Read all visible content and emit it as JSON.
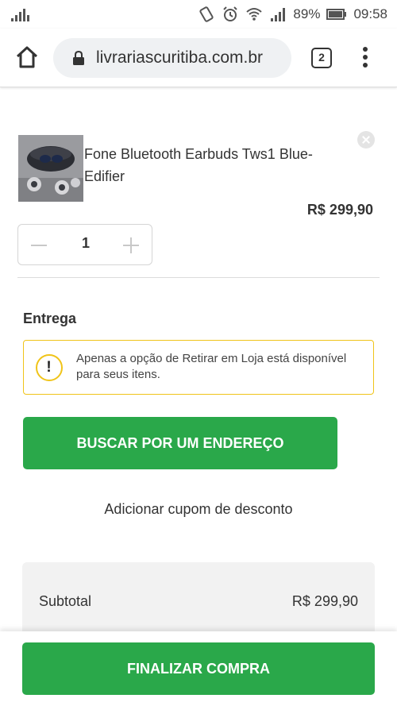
{
  "status_bar": {
    "battery": "89%",
    "time": "09:58",
    "icons": [
      "signal-bars-icon",
      "vibrate-icon",
      "alarm-icon",
      "wifi-icon",
      "cell-signal-icon",
      "battery-icon"
    ]
  },
  "browser": {
    "url": "livrariascuritiba.com.br",
    "tab_count": "2"
  },
  "cart_item": {
    "name": "Fone Bluetooth Earbuds Tws1 Blue- Edifier",
    "price": "R$ 299,90",
    "quantity": "1"
  },
  "delivery": {
    "title": "Entrega",
    "notice_text": "Apenas a opção de Retirar em Loja está disponível para seus itens.",
    "notice_symbol": "!",
    "search_button": "BUSCAR POR UM ENDEREÇO"
  },
  "coupon_link": "Adicionar cupom de desconto",
  "summary": {
    "subtotal_label": "Subtotal",
    "subtotal_value": "R$ 299,90"
  },
  "checkout_button": "FINALIZAR COMPRA",
  "colors": {
    "primary_green": "#2aa84a",
    "notice_yellow": "#f0c419"
  }
}
